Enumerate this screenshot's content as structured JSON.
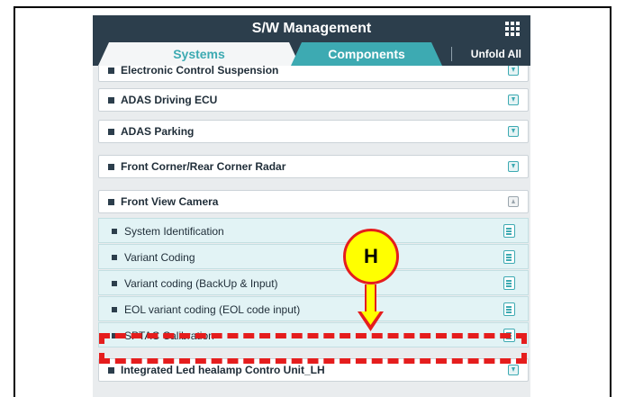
{
  "window": {
    "title": "S/W Management"
  },
  "tabs": {
    "systems": "Systems",
    "components": "Components",
    "unfold_all": "Unfold All"
  },
  "systems": [
    {
      "label": "Electronic Control Suspension",
      "expanded": false
    },
    {
      "label": "ADAS Driving ECU",
      "expanded": false
    },
    {
      "label": "ADAS Parking",
      "expanded": false
    },
    {
      "label": "Front Corner/Rear Corner Radar",
      "expanded": false
    },
    {
      "label": "Front View Camera",
      "expanded": true
    },
    {
      "label": "Integrated Led healamp Contro Unit_LH",
      "expanded": false
    }
  ],
  "front_view_camera_items": [
    {
      "label": "System Identification"
    },
    {
      "label": "Variant Coding"
    },
    {
      "label": "Variant coding (BackUp & Input)"
    },
    {
      "label": "EOL variant coding (EOL code input)"
    },
    {
      "label": "SPTAC Calibration"
    }
  ],
  "callout": {
    "letter": "H",
    "target": "SPTAC Calibration"
  },
  "colors": {
    "header": "#2c3e4c",
    "accent": "#3daab2",
    "callout_red": "#e51d1d",
    "callout_yellow": "#ffff00"
  },
  "icons": {
    "menu": "grid-menu-icon",
    "collapsed": "download-icon",
    "expanded": "collapse-icon",
    "sub_item": "document-icon"
  }
}
